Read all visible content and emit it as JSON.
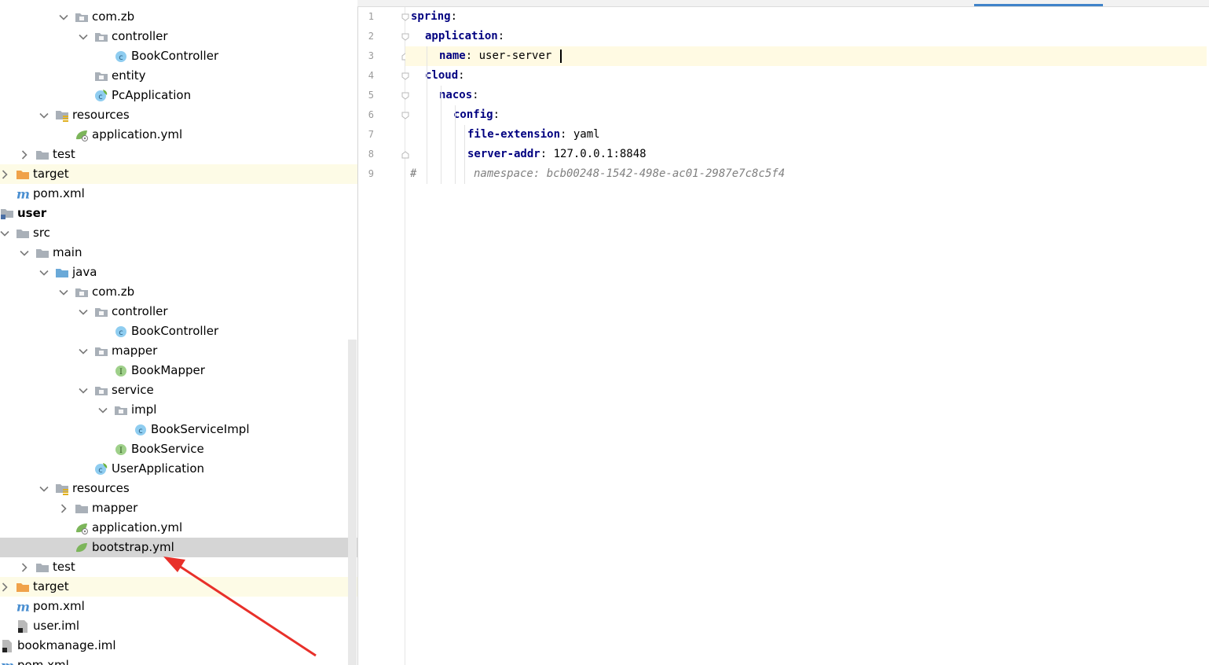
{
  "tree": {
    "rows": [
      {
        "label": "com.zb",
        "kind": "package",
        "chevron": "down",
        "depth": 3
      },
      {
        "label": "controller",
        "kind": "package",
        "chevron": "down",
        "depth": 4
      },
      {
        "label": "BookController",
        "kind": "class",
        "chevron": "none",
        "depth": 5
      },
      {
        "label": "entity",
        "kind": "package",
        "chevron": "none",
        "depth": 4
      },
      {
        "label": "PcApplication",
        "kind": "spring-class",
        "chevron": "none",
        "depth": 4
      },
      {
        "label": "resources",
        "kind": "resources",
        "chevron": "down",
        "depth": 2
      },
      {
        "label": "application.yml",
        "kind": "yml",
        "chevron": "none",
        "depth": 3
      },
      {
        "label": "test",
        "kind": "folder",
        "chevron": "right",
        "depth": 1
      },
      {
        "label": "target",
        "kind": "target",
        "chevron": "right",
        "depth": 0,
        "excluded": true
      },
      {
        "label": "pom.xml",
        "kind": "maven",
        "chevron": "none",
        "depth": 0
      },
      {
        "label": "user",
        "kind": "module",
        "chevron": "none",
        "depth": -1,
        "bold": true
      },
      {
        "label": "src",
        "kind": "folder",
        "chevron": "down",
        "depth": 0
      },
      {
        "label": "main",
        "kind": "folder",
        "chevron": "down",
        "depth": 1
      },
      {
        "label": "java",
        "kind": "source",
        "chevron": "down",
        "depth": 2
      },
      {
        "label": "com.zb",
        "kind": "package",
        "chevron": "down",
        "depth": 3
      },
      {
        "label": "controller",
        "kind": "package",
        "chevron": "down",
        "depth": 4
      },
      {
        "label": "BookController",
        "kind": "class",
        "chevron": "none",
        "depth": 5
      },
      {
        "label": "mapper",
        "kind": "package",
        "chevron": "down",
        "depth": 4
      },
      {
        "label": "BookMapper",
        "kind": "interface",
        "chevron": "none",
        "depth": 5
      },
      {
        "label": "service",
        "kind": "package",
        "chevron": "down",
        "depth": 4
      },
      {
        "label": "impl",
        "kind": "package",
        "chevron": "down",
        "depth": 5
      },
      {
        "label": "BookServiceImpl",
        "kind": "class",
        "chevron": "none",
        "depth": 6
      },
      {
        "label": "BookService",
        "kind": "interface",
        "chevron": "none",
        "depth": 5
      },
      {
        "label": "UserApplication",
        "kind": "spring-class",
        "chevron": "none",
        "depth": 4
      },
      {
        "label": "resources",
        "kind": "resources",
        "chevron": "down",
        "depth": 2
      },
      {
        "label": "mapper",
        "kind": "folder",
        "chevron": "right",
        "depth": 3
      },
      {
        "label": "application.yml",
        "kind": "yml",
        "chevron": "none",
        "depth": 3
      },
      {
        "label": "bootstrap.yml",
        "kind": "yml-leaf",
        "chevron": "none",
        "depth": 3,
        "selected": true
      },
      {
        "label": "test",
        "kind": "folder",
        "chevron": "right",
        "depth": 1
      },
      {
        "label": "target",
        "kind": "target",
        "chevron": "right",
        "depth": 0,
        "excluded": true
      },
      {
        "label": "pom.xml",
        "kind": "maven",
        "chevron": "none",
        "depth": 0
      },
      {
        "label": "user.iml",
        "kind": "iml",
        "chevron": "none",
        "depth": 0
      },
      {
        "label": "bookmanage.iml",
        "kind": "iml",
        "chevron": "none",
        "depth": -1
      },
      {
        "label": "pom.xml",
        "kind": "maven",
        "chevron": "none",
        "depth": -1
      }
    ]
  },
  "editor": {
    "lines": [
      {
        "no": "1",
        "indent": 0,
        "key": "spring",
        "value": "",
        "comment": false
      },
      {
        "no": "2",
        "indent": 1,
        "key": "application",
        "value": "",
        "comment": false
      },
      {
        "no": "3",
        "indent": 2,
        "key": "name",
        "value": "user-server",
        "comment": false,
        "current": true
      },
      {
        "no": "4",
        "indent": 1,
        "key": "cloud",
        "value": "",
        "comment": false
      },
      {
        "no": "5",
        "indent": 2,
        "key": "nacos",
        "value": "",
        "comment": false
      },
      {
        "no": "6",
        "indent": 3,
        "key": "config",
        "value": "",
        "comment": false
      },
      {
        "no": "7",
        "indent": 4,
        "key": "file-extension",
        "value": "yaml",
        "comment": false
      },
      {
        "no": "8",
        "indent": 4,
        "key": "server-addr",
        "value": "127.0.0.1:8848",
        "comment": false
      },
      {
        "no": "9",
        "indent": 0,
        "key": "",
        "value": "",
        "comment": true,
        "comment_hash": "#",
        "comment_text": "namespace: bcb00248-1542-498e-ac01-2987e7c8c5f4"
      }
    ]
  },
  "colors": {
    "yaml_key": "#000080",
    "comment": "#808080",
    "selection": "#d5d5d5",
    "excluded_bg": "#fdfbe6",
    "current_line": "#fffae3",
    "annotation_arrow": "#e8302a",
    "active_tab": "#4083c9"
  },
  "icons": {
    "package": "package-folder-icon",
    "class": "class-c-icon",
    "interface": "interface-i-icon",
    "spring-class": "spring-boot-class-icon",
    "resources": "resources-folder-icon",
    "yml": "spring-yml-icon",
    "folder": "folder-icon",
    "source": "source-root-folder-icon",
    "target": "excluded-folder-icon",
    "maven": "maven-m-icon",
    "module": "module-icon",
    "iml": "iml-file-icon"
  }
}
